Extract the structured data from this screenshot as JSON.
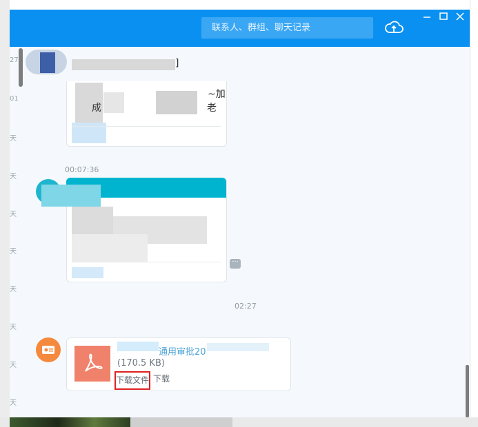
{
  "header": {
    "search_placeholder": "联系人、群组、聊天记录"
  },
  "icons": {
    "cloud": "cloud-upload-icon",
    "minimize": "minimize-icon",
    "maximize": "maximize-icon",
    "close": "close-icon",
    "pdf": "pdf-file-icon",
    "more": "more-icon"
  },
  "date_column": [
    "27",
    "01",
    "天",
    "天",
    "天",
    "天",
    "天",
    "天",
    "天",
    "天",
    "天"
  ],
  "messages": {
    "first_header_fragment": "]",
    "first_text_line1_right": "~加",
    "first_text_line2_right": "老",
    "first_text_line2_mid": "成",
    "second_time": "00:07:36",
    "third_time": "02:27",
    "file": {
      "name_fragment": "通用审批20",
      "size": "(170.5 KB)",
      "download_file_label": "下载文件",
      "download_label": "下载"
    }
  },
  "colors": {
    "titlebar": "#0a90f0",
    "accent_card_header": "#00b4d0",
    "avatar_orange": "#f5893d",
    "pdf_icon": "#f0816a",
    "highlight_box": "#e02020"
  }
}
